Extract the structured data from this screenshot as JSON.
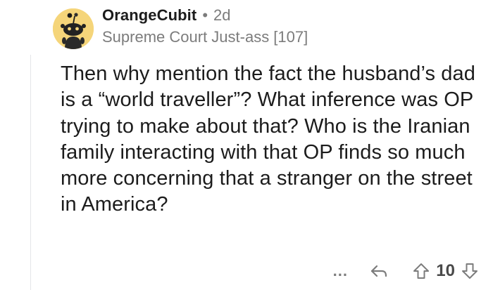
{
  "comment": {
    "author": "OrangeCubit",
    "separator": "•",
    "age": "2d",
    "flair": "Supreme Court Just-ass [107]",
    "body": "Then why mention the fact the husband’s dad is a “world traveller”? What inference was OP trying to make about that? Who is the Iranian family interacting with that OP finds so much more concerning that a stranger on the street in America?",
    "score": "10"
  },
  "actions": {
    "more_label": "...",
    "reply_icon": "reply-arrow-icon",
    "upvote_icon": "upvote-arrow-icon",
    "downvote_icon": "downvote-arrow-icon"
  },
  "colors": {
    "avatar_bg": "#f5d57a",
    "meta_gray": "#7c7c7c",
    "text": "#1c1c1c"
  }
}
